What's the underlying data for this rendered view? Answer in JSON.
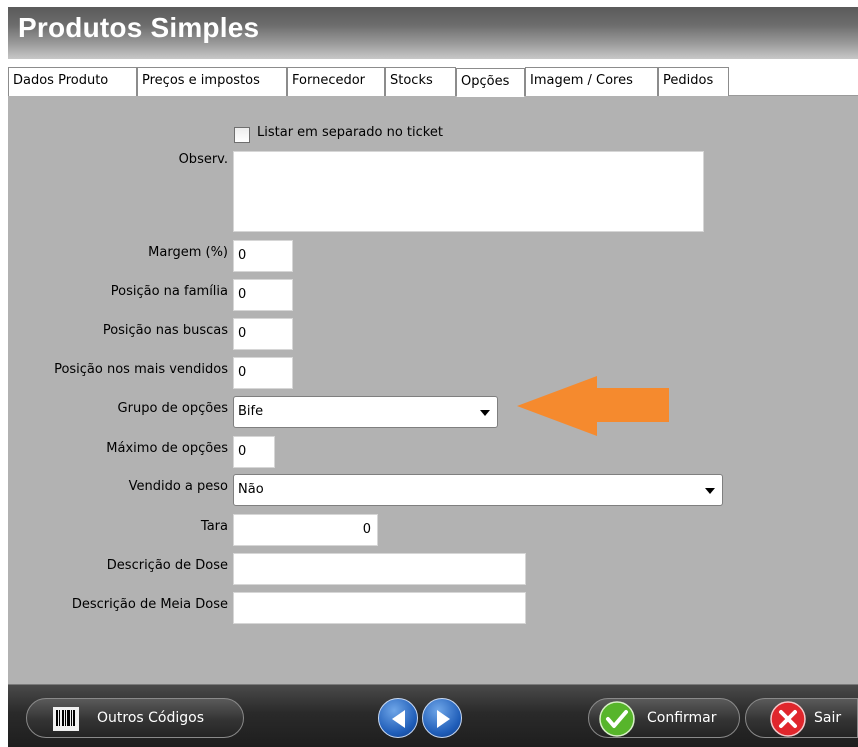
{
  "window": {
    "title": "Produtos Simples"
  },
  "tabs": [
    {
      "label": "Dados Produto"
    },
    {
      "label": "Preços e impostos"
    },
    {
      "label": "Fornecedor"
    },
    {
      "label": "Stocks"
    },
    {
      "label": "Opções",
      "active": true
    },
    {
      "label": "Imagem / Cores"
    },
    {
      "label": "Pedidos"
    }
  ],
  "form": {
    "listar_separado": {
      "label": "Listar em separado no ticket",
      "checked": false
    },
    "observ": {
      "label": "Observ.",
      "value": ""
    },
    "margem": {
      "label": "Margem (%)",
      "value": "0"
    },
    "posicao_familia": {
      "label": "Posição na família",
      "value": "0"
    },
    "posicao_buscas": {
      "label": "Posição nas buscas",
      "value": "0"
    },
    "posicao_mais_vendidos": {
      "label": "Posição nos mais vendidos",
      "value": "0"
    },
    "grupo_opcoes": {
      "label": "Grupo de opções",
      "value": "Bife"
    },
    "maximo_opcoes": {
      "label": "Máximo de opções",
      "value": "0"
    },
    "vendido_peso": {
      "label": "Vendido a peso",
      "value": "Não"
    },
    "tara": {
      "label": "Tara",
      "value": "0"
    },
    "descricao_dose": {
      "label": "Descrição de Dose",
      "value": ""
    },
    "descricao_meia_dose": {
      "label": "Descrição de Meia Dose",
      "value": ""
    }
  },
  "annotation": {
    "icon": "orange-arrow-left-icon",
    "color": "#f58a2e"
  },
  "bottom": {
    "outros_codigos": {
      "label": "Outros Códigos",
      "icon": "barcode-icon"
    },
    "prev": {
      "icon": "arrow-left-icon"
    },
    "next": {
      "icon": "arrow-right-icon"
    },
    "confirmar": {
      "label": "Confirmar",
      "icon": "check-icon",
      "color": "#57b52b"
    },
    "sair": {
      "label": "Sair",
      "icon": "close-icon",
      "color": "#e0262c"
    }
  },
  "colors": {
    "panel": "#b2b2b2",
    "accent_orange": "#f58a2e",
    "bottom_bar": "#2a2a2a"
  }
}
